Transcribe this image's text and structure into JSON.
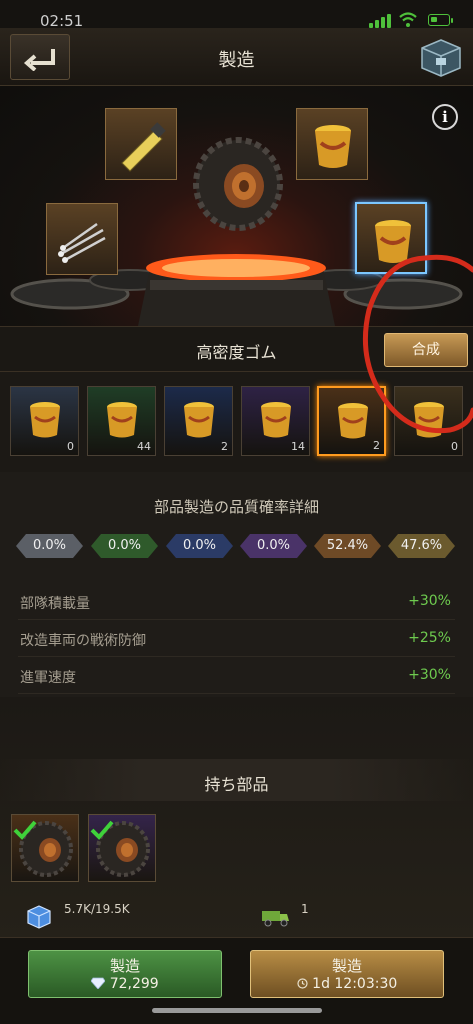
{
  "status_bar": {
    "time": "02:51"
  },
  "header": {
    "title": "製造",
    "back_icon": "back-arrow-icon",
    "chest_icon": "chest-icon"
  },
  "scene": {
    "info_icon": "info-icon",
    "info_label": "i",
    "center_item": "tire-icon",
    "slots": [
      "glue-tube-icon",
      "rubber-bucket-icon",
      "rivets-icon",
      "rubber-bucket-icon"
    ]
  },
  "recipe": {
    "name": "高密度ゴム",
    "synthesize_label": "合成"
  },
  "quality_slots": [
    {
      "count": "0",
      "color": "#2b3545"
    },
    {
      "count": "44",
      "color": "#1f3d26"
    },
    {
      "count": "2",
      "color": "#1c2a4a"
    },
    {
      "count": "14",
      "color": "#2e2245"
    },
    {
      "count": "2",
      "color": "#4a3018",
      "selected": true
    },
    {
      "count": "0",
      "color": "#3a2f1d"
    }
  ],
  "probability": {
    "title": "部品製造の品質確率詳細",
    "rates": [
      {
        "value": "0.0%",
        "color": "#5b5f66"
      },
      {
        "value": "0.0%",
        "color": "#2f5a2b"
      },
      {
        "value": "0.0%",
        "color": "#2b3b66"
      },
      {
        "value": "0.0%",
        "color": "#4a3368"
      },
      {
        "value": "52.4%",
        "color": "#6e4a26"
      },
      {
        "value": "47.6%",
        "color": "#6b5a2e"
      }
    ]
  },
  "stats": [
    {
      "label": "部隊積載量",
      "value": "+30%"
    },
    {
      "label": "改造車両の戦術防御",
      "value": "+25%"
    },
    {
      "label": "進軍速度",
      "value": "+30%"
    }
  ],
  "owned": {
    "title": "持ち部品",
    "parts": [
      {
        "icon": "tire-icon",
        "checked": true,
        "color": "#4a3018"
      },
      {
        "icon": "tire-icon",
        "checked": true,
        "color": "#34244a"
      }
    ],
    "resources": [
      {
        "icon": "cube-icon",
        "value": "5.7K/19.5K"
      },
      {
        "icon": "truck-icon",
        "value": "1"
      }
    ]
  },
  "actions": {
    "left": {
      "label": "製造",
      "cost_icon": "diamond-icon",
      "cost": "72,299",
      "color": "#3f7d36"
    },
    "right": {
      "label": "製造",
      "time_icon": "clock-icon",
      "time": "1d 12:03:30",
      "color": "#8c6a30"
    }
  }
}
